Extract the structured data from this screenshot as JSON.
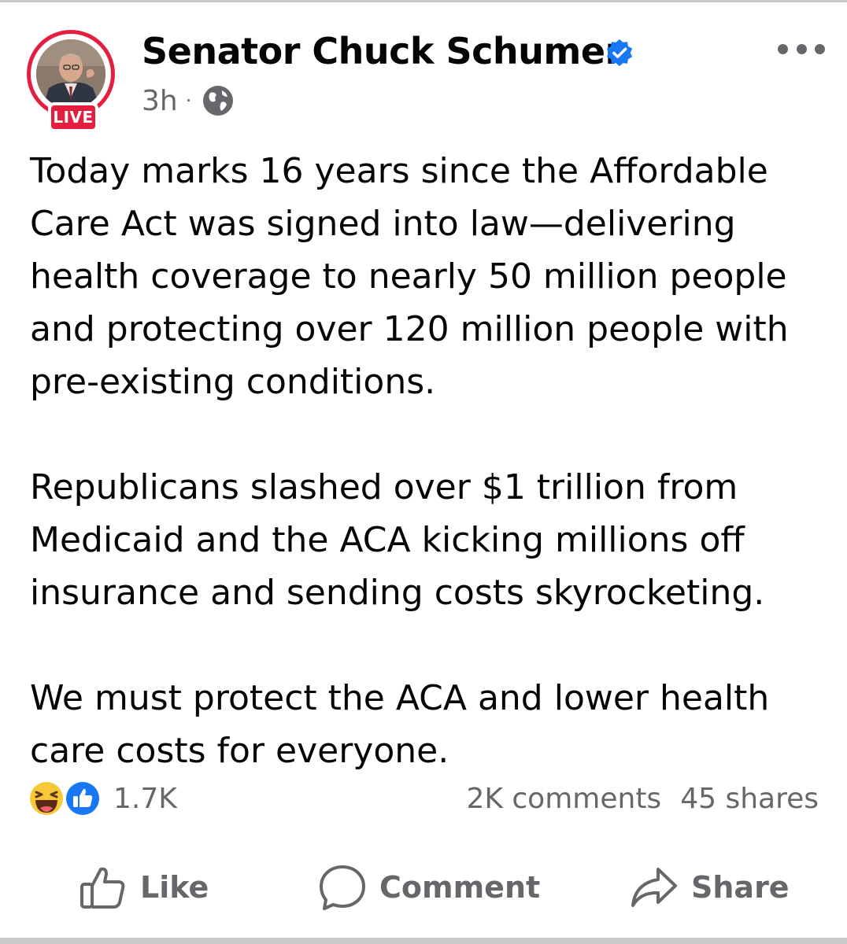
{
  "post": {
    "author": "Senator Chuck Schumer",
    "live_badge": "LIVE",
    "time": "3h",
    "separator": "·",
    "paragraphs": [
      "Today marks 16 years since the Affordable Care Act was signed into law—delivering health coverage to nearly 50 million people and protecting over 120 million people with pre-existing conditions.",
      "Republicans slashed over $1 trillion from Medicaid and the ACA kicking millions off insurance and sending costs skyrocketing.",
      "We must protect the ACA and lower health care costs for everyone."
    ]
  },
  "stats": {
    "reactions": "1.7K",
    "comments": "2K comments",
    "shares": "45 shares"
  },
  "actions": {
    "like": "Like",
    "comment": "Comment",
    "share": "Share"
  },
  "icons": {
    "verified": "verified-badge-icon",
    "audience": "globe-icon",
    "more": "more-options-icon",
    "reaction_1": "haha-reaction-icon",
    "reaction_2": "like-reaction-icon"
  },
  "colors": {
    "live_red": "#e41e3f",
    "facebook_blue": "#1877f2",
    "secondary_text": "#65676b",
    "primary_text": "#050505"
  }
}
